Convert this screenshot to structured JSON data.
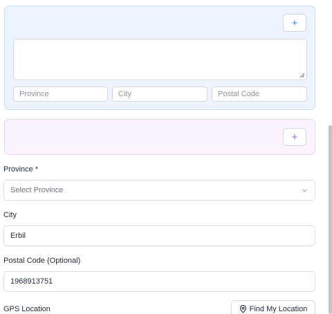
{
  "address_card": {
    "add_label": "+",
    "textarea_value": "",
    "province_placeholder": "Province",
    "city_placeholder": "City",
    "postal_placeholder": "Postal Code"
  },
  "secondary_card": {
    "add_label": "+"
  },
  "province": {
    "label": "Province *",
    "placeholder": "Select Province"
  },
  "city": {
    "label": "City",
    "value": "Erbil"
  },
  "postal": {
    "label": "Postal Code (Optional)",
    "value": "1968913751"
  },
  "gps": {
    "label": "GPS Location",
    "button_label": "Find My Location",
    "icon": "map-pin-icon"
  },
  "colors": {
    "accent_blue": "#3b82f6",
    "accent_purple": "#a855f7",
    "card_blue_bg": "#eef4ff",
    "card_purple_bg": "#fbf4fe"
  }
}
